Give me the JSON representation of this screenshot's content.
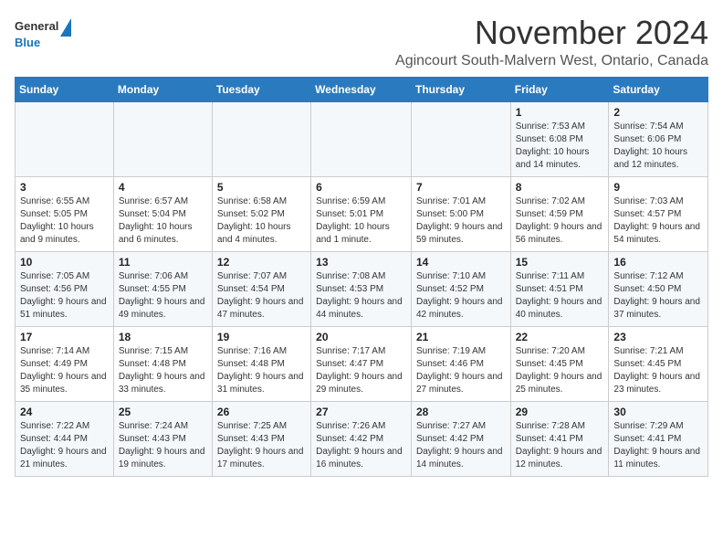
{
  "header": {
    "logo_general": "General",
    "logo_blue": "Blue",
    "month": "November 2024",
    "location": "Agincourt South-Malvern West, Ontario, Canada"
  },
  "days_of_week": [
    "Sunday",
    "Monday",
    "Tuesday",
    "Wednesday",
    "Thursday",
    "Friday",
    "Saturday"
  ],
  "weeks": [
    [
      {
        "day": "",
        "info": ""
      },
      {
        "day": "",
        "info": ""
      },
      {
        "day": "",
        "info": ""
      },
      {
        "day": "",
        "info": ""
      },
      {
        "day": "",
        "info": ""
      },
      {
        "day": "1",
        "info": "Sunrise: 7:53 AM\nSunset: 6:08 PM\nDaylight: 10 hours and 14 minutes."
      },
      {
        "day": "2",
        "info": "Sunrise: 7:54 AM\nSunset: 6:06 PM\nDaylight: 10 hours and 12 minutes."
      }
    ],
    [
      {
        "day": "3",
        "info": "Sunrise: 6:55 AM\nSunset: 5:05 PM\nDaylight: 10 hours and 9 minutes."
      },
      {
        "day": "4",
        "info": "Sunrise: 6:57 AM\nSunset: 5:04 PM\nDaylight: 10 hours and 6 minutes."
      },
      {
        "day": "5",
        "info": "Sunrise: 6:58 AM\nSunset: 5:02 PM\nDaylight: 10 hours and 4 minutes."
      },
      {
        "day": "6",
        "info": "Sunrise: 6:59 AM\nSunset: 5:01 PM\nDaylight: 10 hours and 1 minute."
      },
      {
        "day": "7",
        "info": "Sunrise: 7:01 AM\nSunset: 5:00 PM\nDaylight: 9 hours and 59 minutes."
      },
      {
        "day": "8",
        "info": "Sunrise: 7:02 AM\nSunset: 4:59 PM\nDaylight: 9 hours and 56 minutes."
      },
      {
        "day": "9",
        "info": "Sunrise: 7:03 AM\nSunset: 4:57 PM\nDaylight: 9 hours and 54 minutes."
      }
    ],
    [
      {
        "day": "10",
        "info": "Sunrise: 7:05 AM\nSunset: 4:56 PM\nDaylight: 9 hours and 51 minutes."
      },
      {
        "day": "11",
        "info": "Sunrise: 7:06 AM\nSunset: 4:55 PM\nDaylight: 9 hours and 49 minutes."
      },
      {
        "day": "12",
        "info": "Sunrise: 7:07 AM\nSunset: 4:54 PM\nDaylight: 9 hours and 47 minutes."
      },
      {
        "day": "13",
        "info": "Sunrise: 7:08 AM\nSunset: 4:53 PM\nDaylight: 9 hours and 44 minutes."
      },
      {
        "day": "14",
        "info": "Sunrise: 7:10 AM\nSunset: 4:52 PM\nDaylight: 9 hours and 42 minutes."
      },
      {
        "day": "15",
        "info": "Sunrise: 7:11 AM\nSunset: 4:51 PM\nDaylight: 9 hours and 40 minutes."
      },
      {
        "day": "16",
        "info": "Sunrise: 7:12 AM\nSunset: 4:50 PM\nDaylight: 9 hours and 37 minutes."
      }
    ],
    [
      {
        "day": "17",
        "info": "Sunrise: 7:14 AM\nSunset: 4:49 PM\nDaylight: 9 hours and 35 minutes."
      },
      {
        "day": "18",
        "info": "Sunrise: 7:15 AM\nSunset: 4:48 PM\nDaylight: 9 hours and 33 minutes."
      },
      {
        "day": "19",
        "info": "Sunrise: 7:16 AM\nSunset: 4:48 PM\nDaylight: 9 hours and 31 minutes."
      },
      {
        "day": "20",
        "info": "Sunrise: 7:17 AM\nSunset: 4:47 PM\nDaylight: 9 hours and 29 minutes."
      },
      {
        "day": "21",
        "info": "Sunrise: 7:19 AM\nSunset: 4:46 PM\nDaylight: 9 hours and 27 minutes."
      },
      {
        "day": "22",
        "info": "Sunrise: 7:20 AM\nSunset: 4:45 PM\nDaylight: 9 hours and 25 minutes."
      },
      {
        "day": "23",
        "info": "Sunrise: 7:21 AM\nSunset: 4:45 PM\nDaylight: 9 hours and 23 minutes."
      }
    ],
    [
      {
        "day": "24",
        "info": "Sunrise: 7:22 AM\nSunset: 4:44 PM\nDaylight: 9 hours and 21 minutes."
      },
      {
        "day": "25",
        "info": "Sunrise: 7:24 AM\nSunset: 4:43 PM\nDaylight: 9 hours and 19 minutes."
      },
      {
        "day": "26",
        "info": "Sunrise: 7:25 AM\nSunset: 4:43 PM\nDaylight: 9 hours and 17 minutes."
      },
      {
        "day": "27",
        "info": "Sunrise: 7:26 AM\nSunset: 4:42 PM\nDaylight: 9 hours and 16 minutes."
      },
      {
        "day": "28",
        "info": "Sunrise: 7:27 AM\nSunset: 4:42 PM\nDaylight: 9 hours and 14 minutes."
      },
      {
        "day": "29",
        "info": "Sunrise: 7:28 AM\nSunset: 4:41 PM\nDaylight: 9 hours and 12 minutes."
      },
      {
        "day": "30",
        "info": "Sunrise: 7:29 AM\nSunset: 4:41 PM\nDaylight: 9 hours and 11 minutes."
      }
    ]
  ]
}
